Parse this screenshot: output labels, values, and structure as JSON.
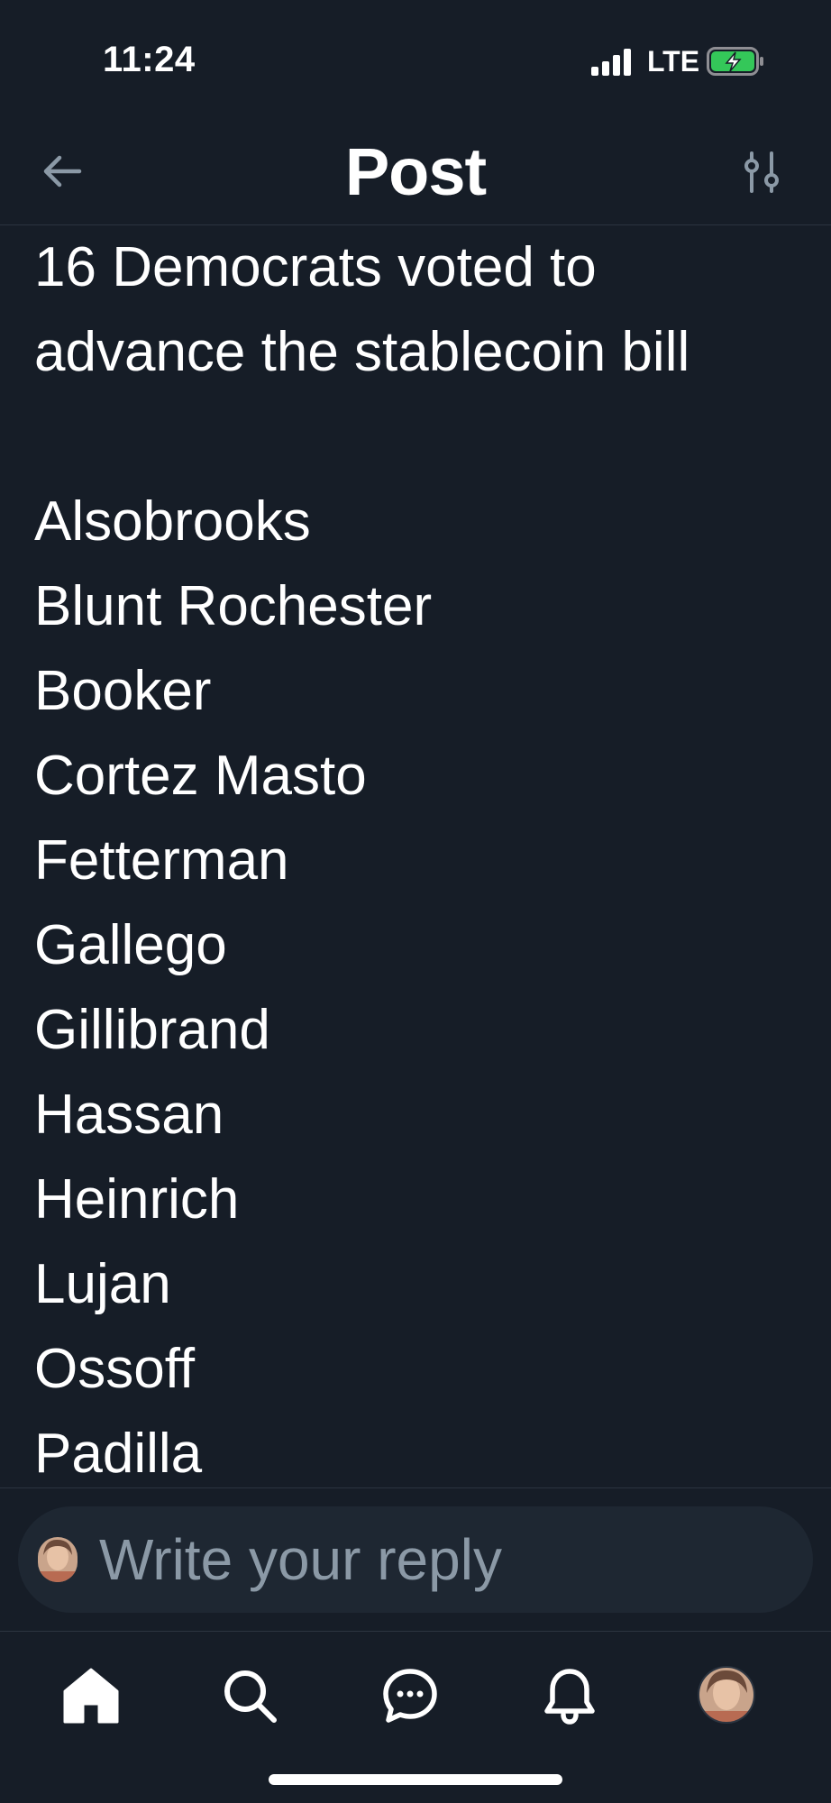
{
  "status_bar": {
    "time": "11:24",
    "network": "LTE",
    "battery_icon": "battery-charging-icon",
    "signal_icon": "signal-icon"
  },
  "header": {
    "title": "Post",
    "back_icon": "arrow-left-icon",
    "settings_icon": "sliders-icon"
  },
  "post": {
    "intro_lines": [
      "16 Democrats voted to",
      "advance the stablecoin bill"
    ],
    "names": [
      "Alsobrooks",
      "Blunt Rochester",
      "Booker",
      "Cortez Masto",
      "Fetterman",
      "Gallego",
      "Gillibrand",
      "Hassan",
      "Heinrich",
      "Lujan",
      "Ossoff",
      "Padilla"
    ]
  },
  "reply": {
    "placeholder": "Write your reply",
    "avatar_icon": "user-avatar"
  },
  "tab_bar": {
    "items": [
      {
        "icon": "home-icon",
        "active": true
      },
      {
        "icon": "search-icon",
        "active": false
      },
      {
        "icon": "chat-icon",
        "active": false
      },
      {
        "icon": "bell-icon",
        "active": false
      },
      {
        "icon": "profile-avatar",
        "active": false
      }
    ]
  },
  "colors": {
    "background": "#161d27",
    "text": "#ffffff",
    "muted": "#8b99a6",
    "reply_box": "#1e2732",
    "battery_green": "#34c759"
  }
}
